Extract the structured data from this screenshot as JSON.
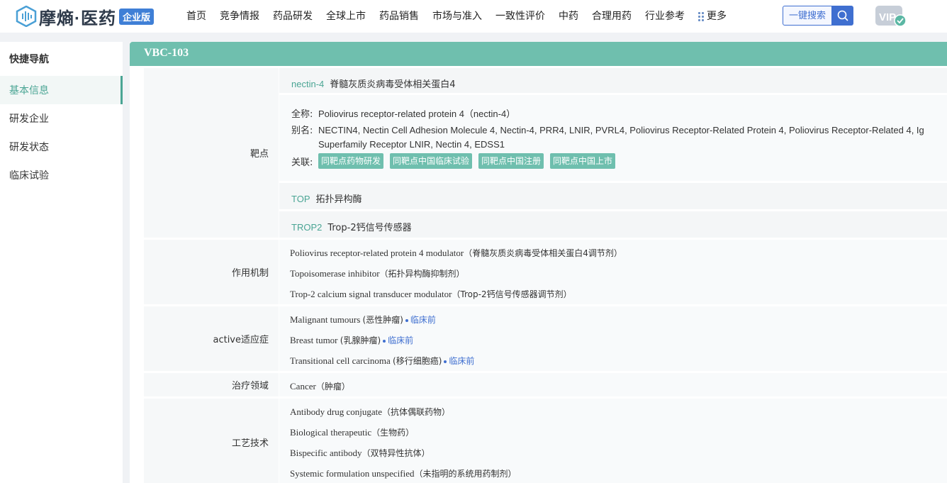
{
  "header": {
    "logo_text": "摩熵·医药",
    "logo_badge": "企业版",
    "nav": [
      "首页",
      "竞争情报",
      "药品研发",
      "全球上市",
      "药品销售",
      "市场与准入",
      "一致性评价",
      "中药",
      "合理用药",
      "行业参考"
    ],
    "nav_more": "更多",
    "search_label": "一键搜索",
    "vip_label": "VIP"
  },
  "sidebar": {
    "title": "快捷导航",
    "items": [
      "基本信息",
      "研发企业",
      "研发状态",
      "临床试验"
    ]
  },
  "drug": {
    "name": "VBC-103"
  },
  "targets": {
    "label": "靶点",
    "t1": {
      "code": "nectin-4",
      "name": "脊髓灰质炎病毒受体相关蛋白4"
    },
    "detail": {
      "fullname_label": "全称:",
      "fullname": "Poliovirus receptor-related protein 4（nectin-4）",
      "alias_label": "别名:",
      "alias_line1": "NECTIN4, Nectin Cell Adhesion Molecule 4, Nectin-4, PRR4, LNIR, PVRL4, Poliovirus Receptor-Related Protein 4, Poliovirus Receptor-Related 4, Ig",
      "alias_line2": "Superfamily Receptor LNIR, Nectin 4, EDSS1",
      "related_label": "关联:",
      "tags": [
        "同靶点药物研发",
        "同靶点中国临床试验",
        "同靶点中国注册",
        "同靶点中国上市"
      ]
    },
    "t2": {
      "code": "TOP",
      "name": "拓扑异构酶"
    },
    "t3": {
      "code": "TROP2",
      "name": "Trop-2钙信号传感器"
    }
  },
  "mechanism": {
    "label": "作用机制",
    "items": [
      {
        "en": "Poliovirus receptor-related protein 4 modulator",
        "zh": "（脊髓灰质炎病毒受体相关蛋白4调节剂）"
      },
      {
        "en": "Topoisomerase inhibitor",
        "zh": "（拓扑异构酶抑制剂）"
      },
      {
        "en": "Trop-2 calcium signal transducer modulator",
        "zh": "（Trop-2钙信号传感器调节剂）"
      }
    ]
  },
  "indication": {
    "label": "active适应症",
    "items": [
      {
        "en": "Malignant tumours",
        "zh": "(恶性肿瘤)",
        "stage": "临床前"
      },
      {
        "en": "Breast tumor",
        "zh": "(乳腺肿瘤)",
        "stage": "临床前"
      },
      {
        "en": "Transitional cell carcinoma",
        "zh": "(移行细胞癌)",
        "stage": "临床前"
      }
    ]
  },
  "therapy": {
    "label": "治疗领域",
    "en": "Cancer",
    "zh": "（肿瘤）"
  },
  "technology": {
    "label": "工艺技术",
    "items": [
      {
        "en": "Antibody drug conjugate",
        "zh": "（抗体偶联药物）"
      },
      {
        "en": "Biological therapeutic",
        "zh": "（生物药）"
      },
      {
        "en": "Bispecific antibody",
        "zh": "（双特异性抗体）"
      },
      {
        "en": "Systemic formulation unspecified",
        "zh": "（未指明的系统用药制剂）"
      }
    ]
  },
  "colors": {
    "accent": "#6fbfae",
    "link": "#3f6fd0"
  }
}
